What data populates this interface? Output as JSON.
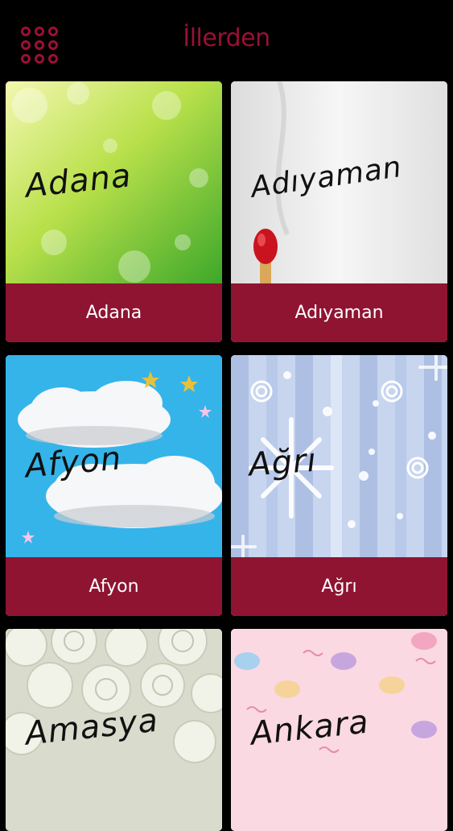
{
  "header": {
    "title": "İllerden",
    "menu_icon": "grid-dots-icon",
    "accent_color": "#9a1035"
  },
  "cities": [
    {
      "label": "Adana",
      "image_text": "Adana",
      "theme": "green-bokeh"
    },
    {
      "label": "Adıyaman",
      "image_text": "Adıyaman",
      "theme": "matchstick"
    },
    {
      "label": "Afyon",
      "image_text": "Afyon",
      "theme": "sky-clouds"
    },
    {
      "label": "Ağrı",
      "image_text": "Ağrı",
      "theme": "snowflake-stripes"
    },
    {
      "label": "",
      "image_text": "Amasya",
      "theme": "white-roses"
    },
    {
      "label": "",
      "image_text": "Ankara",
      "theme": "pink-macarons"
    }
  ],
  "label_bar_color": "#8e1432"
}
